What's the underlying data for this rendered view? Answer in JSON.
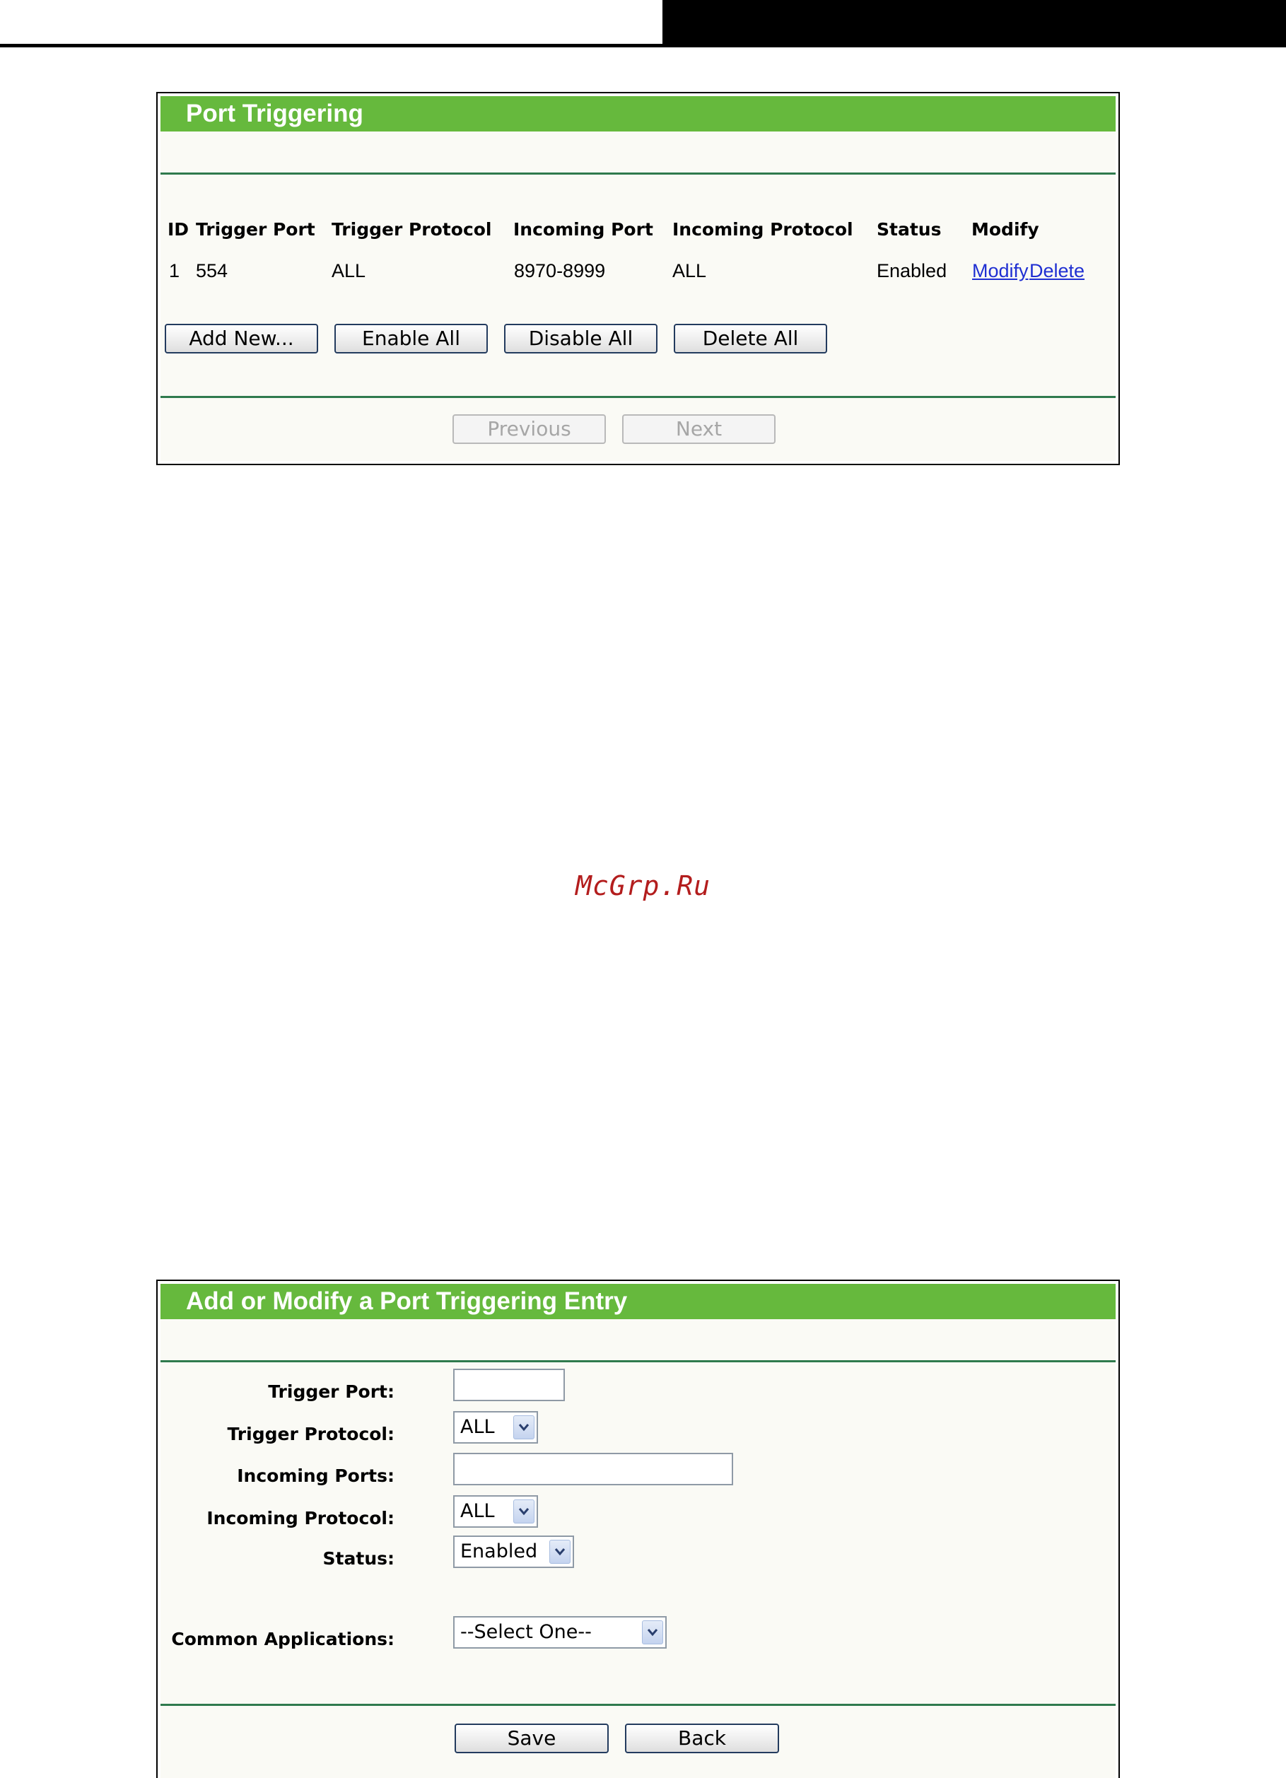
{
  "port_triggering": {
    "title": "Port Triggering",
    "columns": [
      "ID",
      "Trigger Port",
      "Trigger Protocol",
      "Incoming Port",
      "Incoming Protocol",
      "Status",
      "Modify"
    ],
    "rows": [
      {
        "id": "1",
        "trigger_port": "554",
        "trigger_protocol": "ALL",
        "incoming_port": "8970-8999",
        "incoming_protocol": "ALL",
        "status": "Enabled",
        "modify_link": "Modify",
        "delete_link": "Delete"
      }
    ],
    "buttons": {
      "add_new": "Add New...",
      "enable_all": "Enable All",
      "disable_all": "Disable All",
      "delete_all": "Delete All",
      "previous": "Previous",
      "next": "Next"
    }
  },
  "watermark": "McGrp.Ru",
  "entry_form": {
    "title": "Add or Modify a Port Triggering Entry",
    "fields": {
      "trigger_port": {
        "label": "Trigger Port:",
        "value": ""
      },
      "trigger_protocol": {
        "label": "Trigger Protocol:",
        "value": "ALL"
      },
      "incoming_ports": {
        "label": "Incoming Ports:",
        "value": ""
      },
      "incoming_protocol": {
        "label": "Incoming Protocol:",
        "value": "ALL"
      },
      "status": {
        "label": "Status:",
        "value": "Enabled"
      },
      "common_applications": {
        "label": "Common Applications:",
        "value": "--Select One--"
      }
    },
    "buttons": {
      "save": "Save",
      "back": "Back"
    }
  },
  "colors": {
    "header_green": "#66b93d",
    "divider_green": "#2f7a4d",
    "link_blue": "#1f2fd2",
    "watermark_red": "#b31d1d"
  }
}
